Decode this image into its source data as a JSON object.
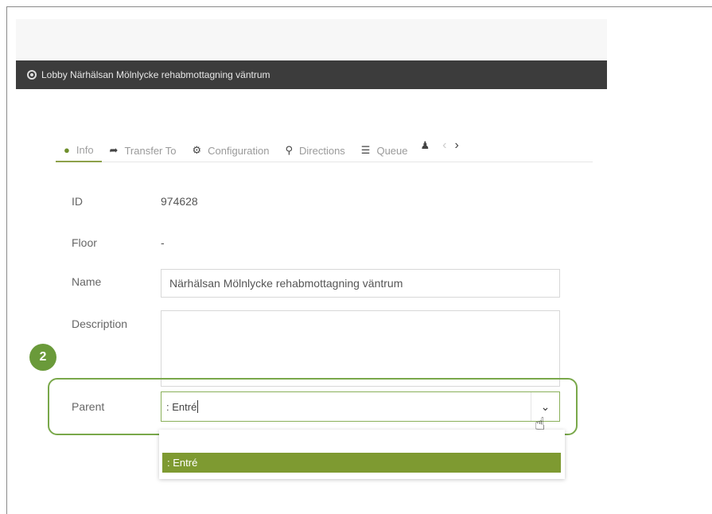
{
  "window": {
    "title": "Lobby Närhälsan Mölnlycke rehabmottagning väntrum",
    "icon": "gear-icon"
  },
  "tabs": [
    {
      "label": "Info",
      "icon": "info-circle-icon",
      "active": true
    },
    {
      "label": "Transfer To",
      "icon": "arrow-forward-icon"
    },
    {
      "label": "Configuration",
      "icon": "gears-icon"
    },
    {
      "label": "Directions",
      "icon": "map-pin-icon"
    },
    {
      "label": "Queue",
      "icon": "list-icon"
    }
  ],
  "fields": {
    "id_label": "ID",
    "id_value": "974628",
    "floor_label": "Floor",
    "floor_value": "-",
    "name_label": "Name",
    "name_value": "Närhälsan Mölnlycke rehabmottagning väntrum",
    "description_label": "Description",
    "description_value": "",
    "parent_label": "Parent",
    "parent_value": ": Entré"
  },
  "callout": {
    "number": "2"
  },
  "dropdown": {
    "options": [
      {
        "label": ": Entré",
        "selected": true
      }
    ]
  },
  "colors": {
    "accent": "#7e9a31",
    "highlight": "#79a84a",
    "titlebar": "#3c3c3c",
    "badge": "#6a9a3a"
  }
}
